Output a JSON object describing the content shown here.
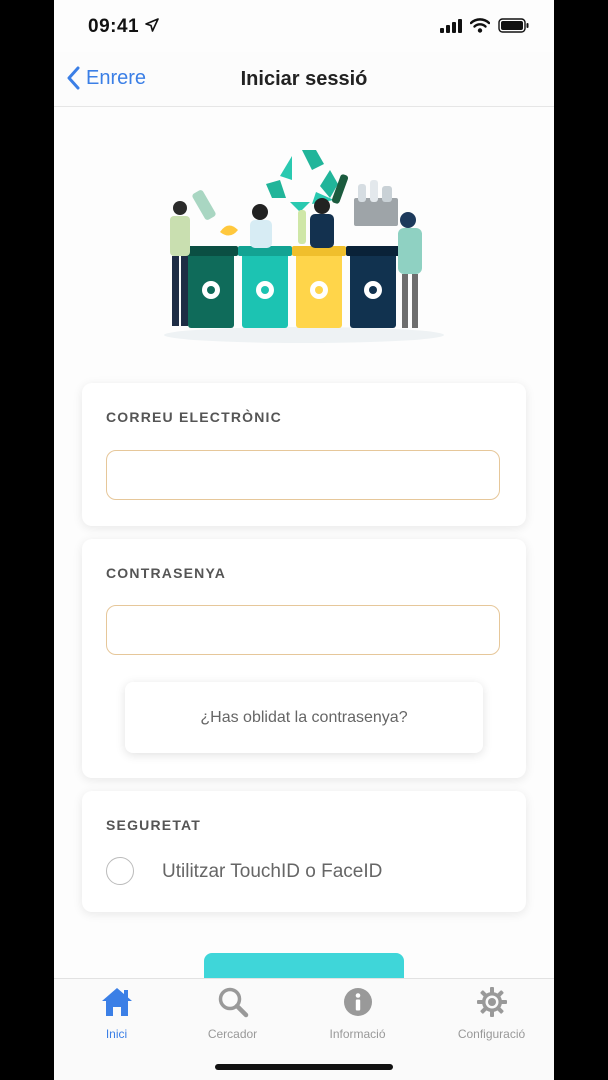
{
  "status_bar": {
    "time": "09:41"
  },
  "nav": {
    "back_label": "Enrere",
    "title": "Iniciar sessió"
  },
  "email_card": {
    "label": "CORREU ELECTRÒNIC",
    "value": "",
    "placeholder": ""
  },
  "password_card": {
    "label": "CONTRASENYA",
    "value": "",
    "placeholder": "",
    "forgot_label": "¿Has oblidat la contrasenya?"
  },
  "security_card": {
    "label": "SEGURETAT",
    "option_label": "Utilitzar TouchID o FaceID",
    "checked": false
  },
  "tabbar": {
    "items": [
      {
        "label": "Inici",
        "icon": "home-icon",
        "active": true
      },
      {
        "label": "Cercador",
        "icon": "search-icon",
        "active": false
      },
      {
        "label": "Informació",
        "icon": "info-icon",
        "active": false
      },
      {
        "label": "Configuració",
        "icon": "gear-icon",
        "active": false
      }
    ]
  },
  "colors": {
    "accent": "#3b7fe6",
    "input_border": "#e6c79a",
    "cta": "#3fd6d9"
  }
}
